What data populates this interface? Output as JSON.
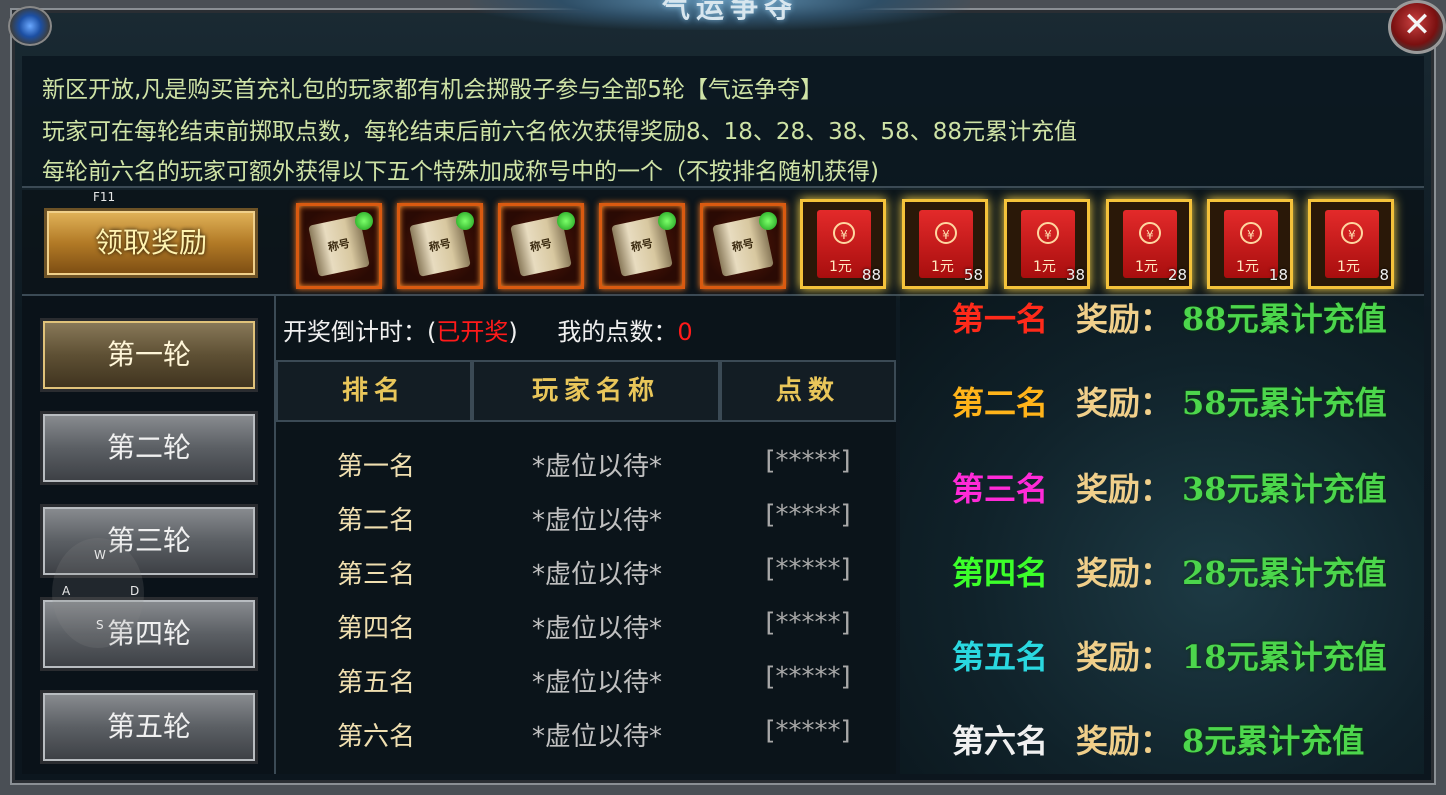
{
  "window": {
    "title": "气运争夺",
    "close_label": "✕"
  },
  "intro": {
    "line1": "新区开放,凡是购买首充礼包的玩家都有机会掷骰子参与全部5轮【气运争夺】",
    "line2": "玩家可在每轮结束前掷取点数，每轮结束后前六名依次获得奖励8、18、28、38、58、88元累计充值",
    "line3": "每轮前六名的玩家可额外获得以下五个特殊加成称号中的一个（不按排名随机获得)"
  },
  "hotkeys": {
    "f11": "F11",
    "w": "W",
    "a": "A",
    "s": "S",
    "d": "D"
  },
  "claim_button": "领取奖励",
  "title_items": [
    {
      "label": "称号"
    },
    {
      "label": "称号"
    },
    {
      "label": "称号"
    },
    {
      "label": "称号"
    },
    {
      "label": "称号"
    }
  ],
  "red_envelopes": [
    {
      "face": "1元",
      "qty": "88"
    },
    {
      "face": "1元",
      "qty": "58"
    },
    {
      "face": "1元",
      "qty": "38"
    },
    {
      "face": "1元",
      "qty": "28"
    },
    {
      "face": "1元",
      "qty": "18"
    },
    {
      "face": "1元",
      "qty": "8"
    }
  ],
  "coin_symbol": "¥",
  "rounds": [
    "第一轮",
    "第二轮",
    "第三轮",
    "第四轮",
    "第五轮"
  ],
  "active_round": "第一轮",
  "countdown": {
    "label": "开奖倒计时：(",
    "status": "已开奖",
    "close": ")",
    "points_label": "我的点数：",
    "points_value": "0"
  },
  "table": {
    "headers": [
      "排名",
      "玩家名称",
      "点数"
    ],
    "rows": [
      {
        "rank": "第一名",
        "name": "*虚位以待*",
        "points": "[*****]"
      },
      {
        "rank": "第二名",
        "name": "*虚位以待*",
        "points": "[*****]"
      },
      {
        "rank": "第三名",
        "name": "*虚位以待*",
        "points": "[*****]"
      },
      {
        "rank": "第四名",
        "name": "*虚位以待*",
        "points": "[*****]"
      },
      {
        "rank": "第五名",
        "name": "*虚位以待*",
        "points": "[*****]"
      },
      {
        "rank": "第六名",
        "name": "*虚位以待*",
        "points": "[*****]"
      }
    ]
  },
  "prizes": [
    {
      "rank": "第一名",
      "label": "奖励：",
      "value": "88元累计充值",
      "color": "#ff2a1a"
    },
    {
      "rank": "第二名",
      "label": "奖励：",
      "value": "58元累计充值",
      "color": "#ffb41a"
    },
    {
      "rank": "第三名",
      "label": "奖励：",
      "value": "38元累计充值",
      "color": "#ff2ad8"
    },
    {
      "rank": "第四名",
      "label": "奖励：",
      "value": "28元累计充值",
      "color": "#3cff2a"
    },
    {
      "rank": "第五名",
      "label": "奖励：",
      "value": "18元累计充值",
      "color": "#2ad8e0"
    },
    {
      "rank": "第六名",
      "label": "奖励：",
      "value": "8元累计充值",
      "color": "#f0f0f0"
    }
  ]
}
